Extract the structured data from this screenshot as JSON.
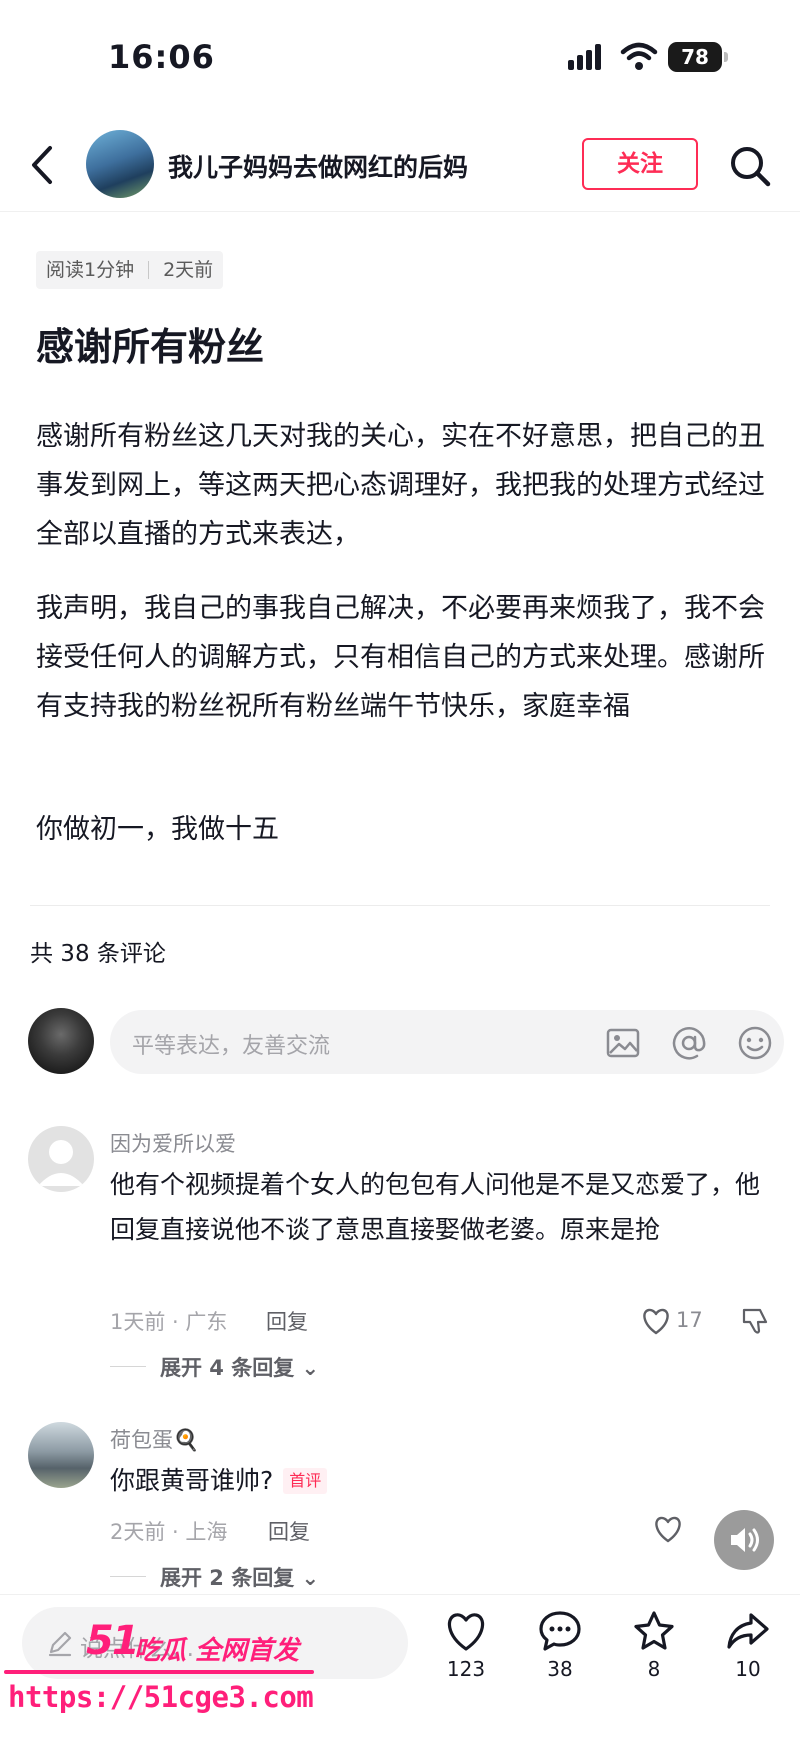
{
  "status_bar": {
    "time": "16:06",
    "battery": "78"
  },
  "header": {
    "account_name": "我儿子妈妈去做网红的后妈",
    "follow_label": "关注"
  },
  "article": {
    "read_time": "阅读1分钟",
    "posted": "2天前",
    "title": "感谢所有粉丝",
    "paragraphs": [
      "感谢所有粉丝这几天对我的关心，实在不好意思，把自己的丑事发到网上，等这两天把心态调理好，我把我的处理方式经过全部以直播的方式来表达，",
      "我声明，我自己的事我自己解决，不必要再来烦我了，我不会接受任何人的调解方式，只有相信自己的方式来处理。感谢所有支持我的粉丝祝所有粉丝端午节快乐，家庭幸福",
      "你做初一，我做十五"
    ]
  },
  "comments_section": {
    "count_label": "共 38 条评论",
    "input_placeholder": "平等表达，友善交流",
    "comments": [
      {
        "username": "因为爱所以爱",
        "text": "他有个视频提着个女人的包包有人问他是不是又恋爱了，他回复直接说他不谈了意思直接娶做老婆。原来是抢",
        "meta": "1天前 · 广东",
        "reply_label": "回复",
        "likes": "17",
        "expand_label": "展开 4 条回复"
      },
      {
        "username": "荷包蛋🍳",
        "text": "你跟黄哥谁帅?",
        "badge": "首评",
        "meta": "2天前 · 上海",
        "reply_label": "回复",
        "expand_label": "展开 2 条回复"
      }
    ]
  },
  "bottom_bar": {
    "input_placeholder": "说点什么...",
    "likes": "123",
    "comments": "38",
    "favorites": "8",
    "shares": "10"
  },
  "watermark": {
    "logo": "51",
    "slogan": "吃瓜 全网首发",
    "url": "https://51cge3.com"
  },
  "colors": {
    "accent": "#fe2c55",
    "watermark": "#ff1f7a",
    "text": "#161823",
    "muted": "#a5a5aa"
  }
}
